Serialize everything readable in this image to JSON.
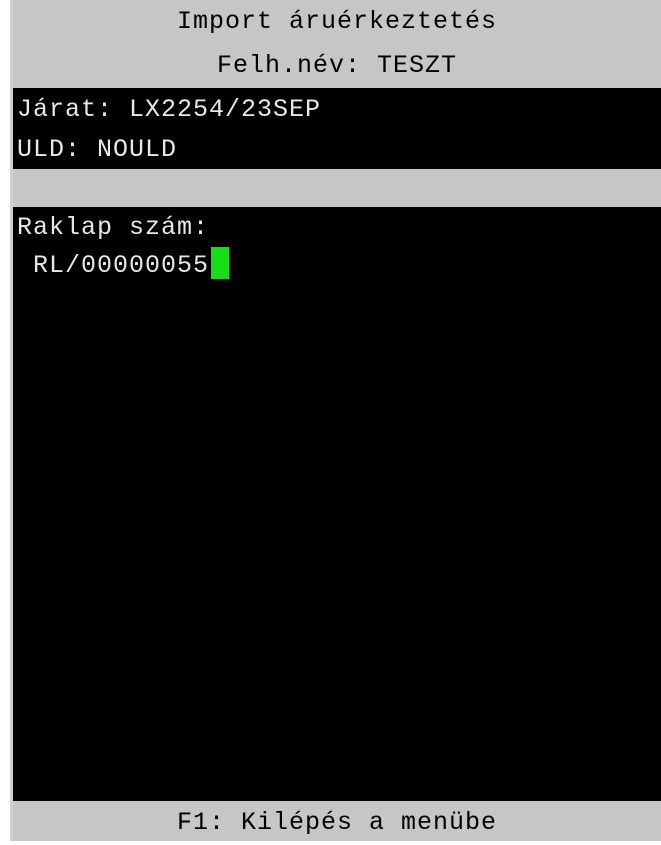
{
  "header": {
    "title": "Import áruérkeztetés",
    "user_line": "Felh.név: TESZT"
  },
  "flight": {
    "text": "Járat: LX2254/23SEP"
  },
  "uld": {
    "text": "ULD: NOULD"
  },
  "pallet": {
    "label": "Raklap szám:",
    "value": "RL/00000055"
  },
  "footer": {
    "text": "F1: Kilépés a menübe"
  },
  "colors": {
    "background": "#000000",
    "bar": "#c6c6c6",
    "text": "#e8e8e8",
    "cursor": "#14e01a"
  }
}
